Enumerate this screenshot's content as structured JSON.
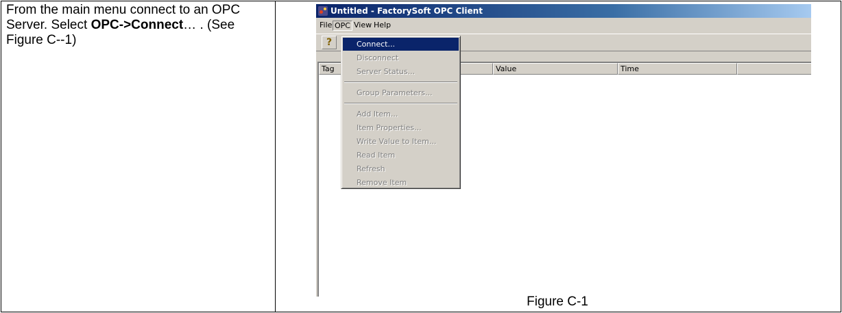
{
  "instruction": {
    "part1": "From the main menu connect to an OPC Server. Select ",
    "bold": "OPC->Connect",
    "part2": "… . (See Figure C--1)"
  },
  "window": {
    "title": "Untitled - FactorySoft OPC Client",
    "app_icon": "factorysoft-app-icon"
  },
  "menubar": [
    "File",
    "OPC",
    "View",
    "Help"
  ],
  "toolbar": {
    "help_button_glyph": "?",
    "help_button_icon": "help-icon"
  },
  "list_columns": [
    "Tag",
    "Value",
    "Time",
    ""
  ],
  "opc_menu": {
    "items": [
      {
        "label": "Connect...",
        "state": "highlighted"
      },
      {
        "label": "Disconnect",
        "state": "disabled"
      },
      {
        "label": "Server Status...",
        "state": "disabled"
      },
      {
        "label": "Group Parameters...",
        "state": "disabled"
      },
      {
        "label": "Add Item...",
        "state": "disabled"
      },
      {
        "label": "Item Properties...",
        "state": "disabled"
      },
      {
        "label": "Write Value to Item...",
        "state": "disabled"
      },
      {
        "label": "Read Item",
        "state": "disabled"
      },
      {
        "label": "Refresh",
        "state": "disabled"
      },
      {
        "label": "Remove Item",
        "state": "disabled"
      }
    ]
  },
  "caption": "Figure C-1",
  "colors": {
    "highlight": "#0a246a",
    "face": "#d4d0c8",
    "disabled_text": "#808080"
  }
}
